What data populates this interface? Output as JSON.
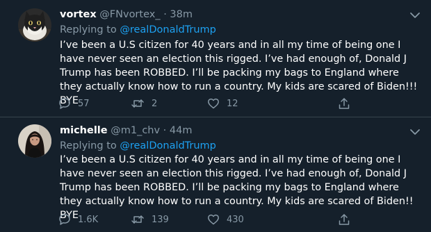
{
  "colors": {
    "background": "#15202b",
    "text": "#ffffff",
    "muted": "#8899a6",
    "link": "#1da1f2",
    "divider": "#38444d"
  },
  "tweets": [
    {
      "display_name": "vortex",
      "handle": "@FNvortex_",
      "separator": "·",
      "time": "38m",
      "replying_prefix": "Replying to",
      "replying_to": "@realDonaldTrump",
      "text": "I’ve been a U.S citizen for 40 years and in all my time of being one I have never seen an election this rigged. I’ve had enough of, Donald J Trump has been ROBBED. I’ll be packing my bags to England where they actually know how to run a country. My kids are scared of Biden!!! BYE",
      "reply_count": "57",
      "retweet_count": "2",
      "like_count": "12",
      "icons": [
        "cat-avatar-icon",
        "chevron-down-icon",
        "reply-icon",
        "retweet-icon",
        "heart-icon",
        "share-icon"
      ]
    },
    {
      "display_name": "michelle",
      "handle": "@m1_chv",
      "separator": "·",
      "time": "44m",
      "replying_prefix": "Replying to",
      "replying_to": "@realDonaldTrump",
      "text": "I’ve been a U.S citizen for 40 years and in all my time of being one I have never seen an election this rigged. I’ve had enough of, Donald J Trump has been ROBBED. I’ll be packing my bags to England where they actually know how to run a country. My kids are scared of Biden!! BYE",
      "reply_count": "1.6K",
      "retweet_count": "139",
      "like_count": "430",
      "icons": [
        "person-avatar-icon",
        "chevron-down-icon",
        "reply-icon",
        "retweet-icon",
        "heart-icon",
        "share-icon"
      ]
    }
  ]
}
